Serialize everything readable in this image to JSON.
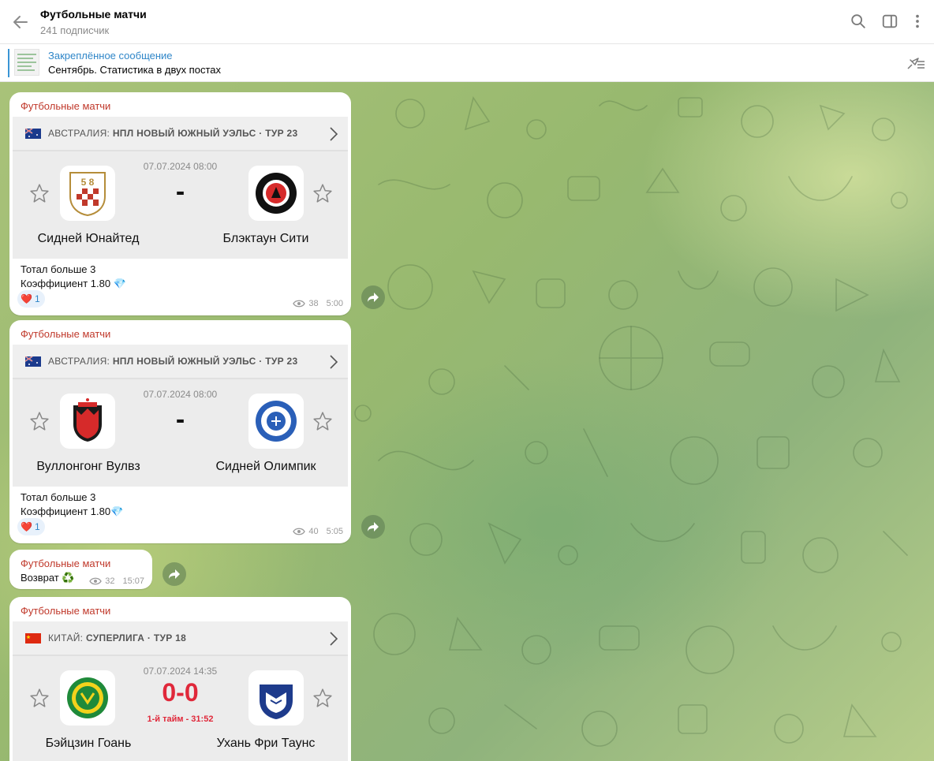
{
  "header": {
    "title": "Футбольные матчи",
    "subtitle": "241 подписчик"
  },
  "pinned": {
    "title": "Закреплённое сообщение",
    "text": "Сентябрь. Статистика в двух постах"
  },
  "messages": [
    {
      "sender": "Футбольные матчи",
      "league_country": "АВСТРАЛИЯ:",
      "league_name": "НПЛ НОВЫЙ ЮЖНЫЙ УЭЛЬС · ТУР 23",
      "datetime": "07.07.2024 08:00",
      "score": "-",
      "home": "Сидней Юнайтед",
      "away": "Блэктаун Сити",
      "line1": "Тотал больше 3",
      "line2": "Коэффициент 1.80 💎",
      "reaction": "❤️",
      "reaction_count": "1",
      "views": "38",
      "time": "5:00"
    },
    {
      "sender": "Футбольные матчи",
      "league_country": "АВСТРАЛИЯ:",
      "league_name": "НПЛ НОВЫЙ ЮЖНЫЙ УЭЛЬС · ТУР 23",
      "datetime": "07.07.2024 08:00",
      "score": "-",
      "home": "Вуллонгонг Вулвз",
      "away": "Сидней Олимпик",
      "line1": "Тотал больше 3",
      "line2": "Коэффициент 1.80💎",
      "reaction": "❤️",
      "reaction_count": "1",
      "views": "40",
      "time": "5:05"
    },
    {
      "sender": "Футбольные матчи",
      "text": "Возврат ♻️",
      "views": "32",
      "time": "15:07"
    },
    {
      "sender": "Футбольные матчи",
      "league_country": "КИТАЙ:",
      "league_name": "СУПЕРЛИГА · ТУР 18",
      "datetime": "07.07.2024 14:35",
      "score": "0-0",
      "period": "1-й тайм - 31:52",
      "home": "Бэйцзин Гоань",
      "away": "Ухань Фри Таунс"
    }
  ],
  "colors": {
    "accent": "#2f86c8",
    "sender": "#c0392b",
    "live": "#e0283a"
  },
  "icons": [
    "back-arrow-icon",
    "search-icon",
    "sidebar-icon",
    "more-icon",
    "unpin-icon",
    "star-icon",
    "chevron-right-icon",
    "forward-icon",
    "eye-icon"
  ]
}
